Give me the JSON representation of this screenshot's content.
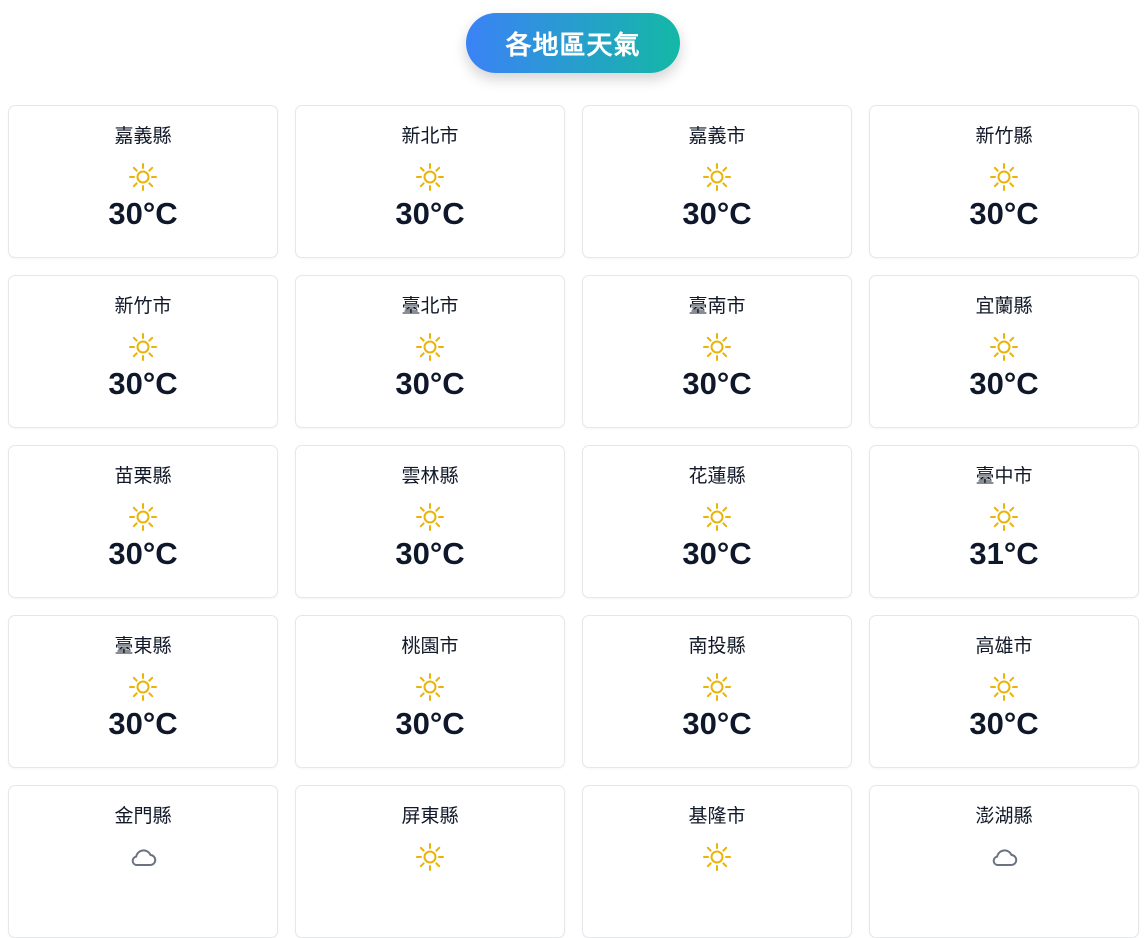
{
  "header": {
    "title": "各地區天氣"
  },
  "colors": {
    "gradient_start": "#3b82f6",
    "gradient_end": "#14b8a6",
    "sun": "#eab308",
    "cloud": "#6b7280"
  },
  "cards": [
    {
      "city": "嘉義縣",
      "icon": "sun-icon",
      "temp": "30°C"
    },
    {
      "city": "新北市",
      "icon": "sun-icon",
      "temp": "30°C"
    },
    {
      "city": "嘉義市",
      "icon": "sun-icon",
      "temp": "30°C"
    },
    {
      "city": "新竹縣",
      "icon": "sun-icon",
      "temp": "30°C"
    },
    {
      "city": "新竹市",
      "icon": "sun-icon",
      "temp": "30°C"
    },
    {
      "city": "臺北市",
      "icon": "sun-icon",
      "temp": "30°C"
    },
    {
      "city": "臺南市",
      "icon": "sun-icon",
      "temp": "30°C"
    },
    {
      "city": "宜蘭縣",
      "icon": "sun-icon",
      "temp": "30°C"
    },
    {
      "city": "苗栗縣",
      "icon": "sun-icon",
      "temp": "30°C"
    },
    {
      "city": "雲林縣",
      "icon": "sun-icon",
      "temp": "30°C"
    },
    {
      "city": "花蓮縣",
      "icon": "sun-icon",
      "temp": "30°C"
    },
    {
      "city": "臺中市",
      "icon": "sun-icon",
      "temp": "31°C"
    },
    {
      "city": "臺東縣",
      "icon": "sun-icon",
      "temp": "30°C"
    },
    {
      "city": "桃園市",
      "icon": "sun-icon",
      "temp": "30°C"
    },
    {
      "city": "南投縣",
      "icon": "sun-icon",
      "temp": "30°C"
    },
    {
      "city": "高雄市",
      "icon": "sun-icon",
      "temp": "30°C"
    },
    {
      "city": "金門縣",
      "icon": "cloud-icon",
      "temp": ""
    },
    {
      "city": "屏東縣",
      "icon": "sun-icon",
      "temp": ""
    },
    {
      "city": "基隆市",
      "icon": "sun-icon",
      "temp": ""
    },
    {
      "city": "澎湖縣",
      "icon": "cloud-icon",
      "temp": ""
    }
  ]
}
